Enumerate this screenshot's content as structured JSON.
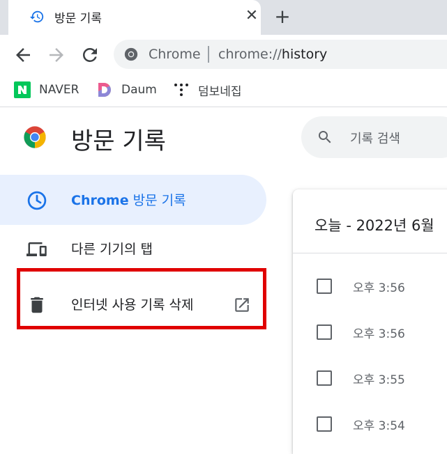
{
  "tab": {
    "title": "방문 기록",
    "favicon": "history-icon",
    "close": "✕",
    "new_tab": "+"
  },
  "toolbar": {
    "back": "back-arrow-icon",
    "forward": "forward-arrow-icon",
    "reload": "reload-icon",
    "site_label": "Chrome",
    "url_prefix": "chrome://",
    "url_path": "history"
  },
  "bookmarks": [
    {
      "label": "NAVER",
      "icon": "naver-icon",
      "color": "#03c75a"
    },
    {
      "label": "Daum",
      "icon": "daum-icon"
    },
    {
      "label": "덤보네집",
      "icon": "dots-icon"
    }
  ],
  "page": {
    "title": "방문 기록",
    "search_placeholder": "기록 검색"
  },
  "sidebar": {
    "items": [
      {
        "label_bold": "Chrome",
        "label_rest": " 방문 기록",
        "icon": "clock-icon",
        "active": true
      },
      {
        "label": "다른 기기의 탭",
        "icon": "devices-icon",
        "active": false
      },
      {
        "label": "인터넷 사용 기록 삭제",
        "icon": "trash-icon",
        "trailing_icon": "open-in-new-icon",
        "active": false
      }
    ]
  },
  "history": {
    "date_header": "오늘 - 2022년 6월",
    "entries": [
      {
        "time": "오후 3:56"
      },
      {
        "time": "오후 3:56"
      },
      {
        "time": "오후 3:55"
      },
      {
        "time": "오후 3:54"
      }
    ]
  },
  "colors": {
    "accent": "#1a73e8",
    "active_bg": "#e8f0fe",
    "highlight": "#e00000",
    "tabstrip": "#dee1e6"
  }
}
